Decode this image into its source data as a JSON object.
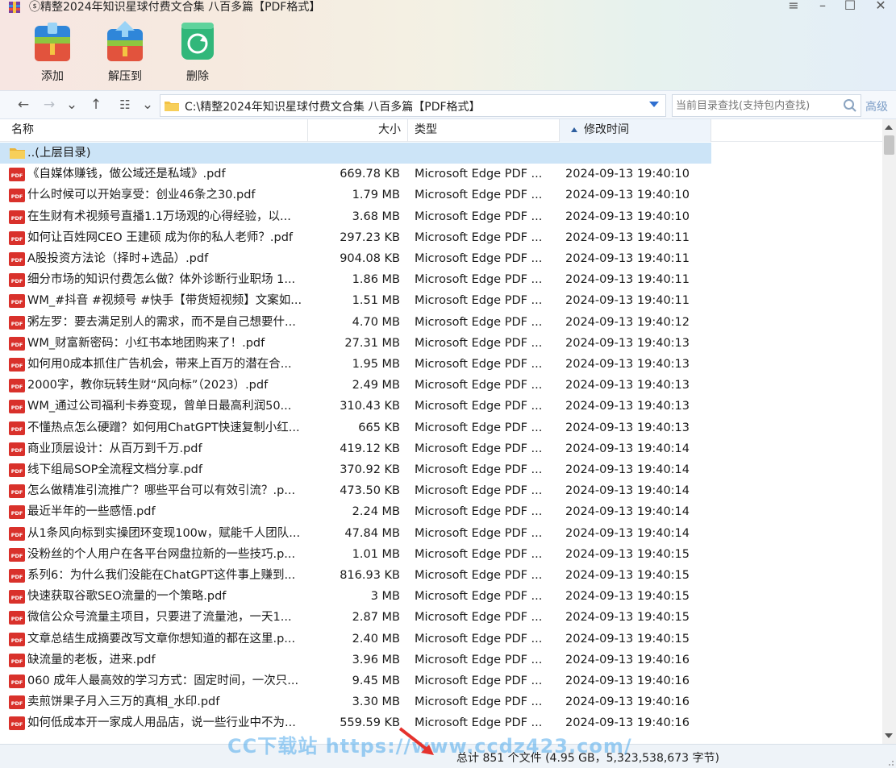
{
  "window": {
    "title": "ⓢ精整2024年知识星球付费文合集 八百多篇【PDF格式】",
    "controls": [
      "≡",
      "–",
      "☐",
      "✕"
    ]
  },
  "toolbar": {
    "add_label": "添加",
    "extract_label": "解压到",
    "delete_label": "删除"
  },
  "nav": {
    "path": "C:\\精整2024年知识星球付费文合集 八百多篇【PDF格式】",
    "search_placeholder": "当前目录查找(支持包内查找)",
    "advanced_label": "高级"
  },
  "columns": {
    "name": "名称",
    "size": "大小",
    "type": "类型",
    "modified": "修改时间"
  },
  "parent_row": {
    "name": "..(上层目录)"
  },
  "files": [
    {
      "name": "《自媒体赚钱，做公域还是私域》.pdf",
      "size": "669.78 KB",
      "type": "Microsoft Edge PDF ...",
      "modified": "2024-09-13 19:40:10"
    },
    {
      "name": "什么时候可以开始享受：创业46条之30.pdf",
      "size": "1.79 MB",
      "type": "Microsoft Edge PDF ...",
      "modified": "2024-09-13 19:40:10"
    },
    {
      "name": "在生财有术视频号直播1.1万场观的心得经验，以...",
      "size": "3.68 MB",
      "type": "Microsoft Edge PDF ...",
      "modified": "2024-09-13 19:40:10"
    },
    {
      "name": "如何让百姓网CEO 王建硕 成为你的私人老师？.pdf",
      "size": "297.23 KB",
      "type": "Microsoft Edge PDF ...",
      "modified": "2024-09-13 19:40:11"
    },
    {
      "name": "A股投资方法论（择时+选品）.pdf",
      "size": "904.08 KB",
      "type": "Microsoft Edge PDF ...",
      "modified": "2024-09-13 19:40:11"
    },
    {
      "name": "细分市场的知识付费怎么做？体外诊断行业职场 1...",
      "size": "1.86 MB",
      "type": "Microsoft Edge PDF ...",
      "modified": "2024-09-13 19:40:11"
    },
    {
      "name": "WM_#抖音 #视频号 #快手【带货短视频】文案如...",
      "size": "1.51 MB",
      "type": "Microsoft Edge PDF ...",
      "modified": "2024-09-13 19:40:11"
    },
    {
      "name": "粥左罗：要去满足别人的需求，而不是自己想要什...",
      "size": "4.70 MB",
      "type": "Microsoft Edge PDF ...",
      "modified": "2024-09-13 19:40:12"
    },
    {
      "name": "WM_财富新密码：小红书本地团购来了！.pdf",
      "size": "27.31 MB",
      "type": "Microsoft Edge PDF ...",
      "modified": "2024-09-13 19:40:13"
    },
    {
      "name": "如何用0成本抓住广告机会，带来上百万的潜在合...",
      "size": "1.95 MB",
      "type": "Microsoft Edge PDF ...",
      "modified": "2024-09-13 19:40:13"
    },
    {
      "name": "2000字，教你玩转生财“风向标”（2023）.pdf",
      "size": "2.49 MB",
      "type": "Microsoft Edge PDF ...",
      "modified": "2024-09-13 19:40:13"
    },
    {
      "name": "WM_通过公司福利卡券变现，曾单日最高利润50...",
      "size": "310.43 KB",
      "type": "Microsoft Edge PDF ...",
      "modified": "2024-09-13 19:40:13"
    },
    {
      "name": "不懂热点怎么硬蹭？如何用ChatGPT快速复制小红...",
      "size": "665 KB",
      "type": "Microsoft Edge PDF ...",
      "modified": "2024-09-13 19:40:13"
    },
    {
      "name": "商业顶层设计：从百万到千万.pdf",
      "size": "419.12 KB",
      "type": "Microsoft Edge PDF ...",
      "modified": "2024-09-13 19:40:14"
    },
    {
      "name": "线下组局SOP全流程文档分享.pdf",
      "size": "370.92 KB",
      "type": "Microsoft Edge PDF ...",
      "modified": "2024-09-13 19:40:14"
    },
    {
      "name": "怎么做精准引流推广？哪些平台可以有效引流？.p...",
      "size": "473.50 KB",
      "type": "Microsoft Edge PDF ...",
      "modified": "2024-09-13 19:40:14"
    },
    {
      "name": "最近半年的一些感悟.pdf",
      "size": "2.24 MB",
      "type": "Microsoft Edge PDF ...",
      "modified": "2024-09-13 19:40:14"
    },
    {
      "name": "从1条风向标到实操团环变现100w，赋能千人团队...",
      "size": "47.84 MB",
      "type": "Microsoft Edge PDF ...",
      "modified": "2024-09-13 19:40:14"
    },
    {
      "name": "没粉丝的个人用户在各平台网盘拉新的一些技巧.p...",
      "size": "1.01 MB",
      "type": "Microsoft Edge PDF ...",
      "modified": "2024-09-13 19:40:15"
    },
    {
      "name": "系列6：为什么我们没能在ChatGPT这件事上赚到...",
      "size": "816.93 KB",
      "type": "Microsoft Edge PDF ...",
      "modified": "2024-09-13 19:40:15"
    },
    {
      "name": "快速获取谷歌SEO流量的一个策略.pdf",
      "size": "3 MB",
      "type": "Microsoft Edge PDF ...",
      "modified": "2024-09-13 19:40:15"
    },
    {
      "name": "微信公众号流量主项目，只要进了流量池，一天1...",
      "size": "2.87 MB",
      "type": "Microsoft Edge PDF ...",
      "modified": "2024-09-13 19:40:15"
    },
    {
      "name": "文章总结生成摘要改写文章你想知道的都在这里.p...",
      "size": "2.40 MB",
      "type": "Microsoft Edge PDF ...",
      "modified": "2024-09-13 19:40:15"
    },
    {
      "name": "缺流量的老板，进来.pdf",
      "size": "3.96 MB",
      "type": "Microsoft Edge PDF ...",
      "modified": "2024-09-13 19:40:16"
    },
    {
      "name": "060 成年人最高效的学习方式：固定时间，一次只...",
      "size": "9.45 MB",
      "type": "Microsoft Edge PDF ...",
      "modified": "2024-09-13 19:40:16"
    },
    {
      "name": "卖煎饼果子月入三万的真相_水印.pdf",
      "size": "3.30 MB",
      "type": "Microsoft Edge PDF ...",
      "modified": "2024-09-13 19:40:16"
    },
    {
      "name": "如何低成本开一家成人用品店，说一些行业中不为...",
      "size": "559.59 KB",
      "type": "Microsoft Edge PDF ...",
      "modified": "2024-09-13 19:40:16"
    }
  ],
  "status": {
    "summary": "总计 851 个文件 (4.95 GB，5,323,538,673 字节)"
  },
  "watermark": "CC下载站 https://www.ccdz423.com/",
  "colors": {
    "selection": "#cce4f7",
    "pdf_red": "#d9312b",
    "folder_yellow": "#f3c244",
    "accent_blue": "#2f6fd0"
  }
}
